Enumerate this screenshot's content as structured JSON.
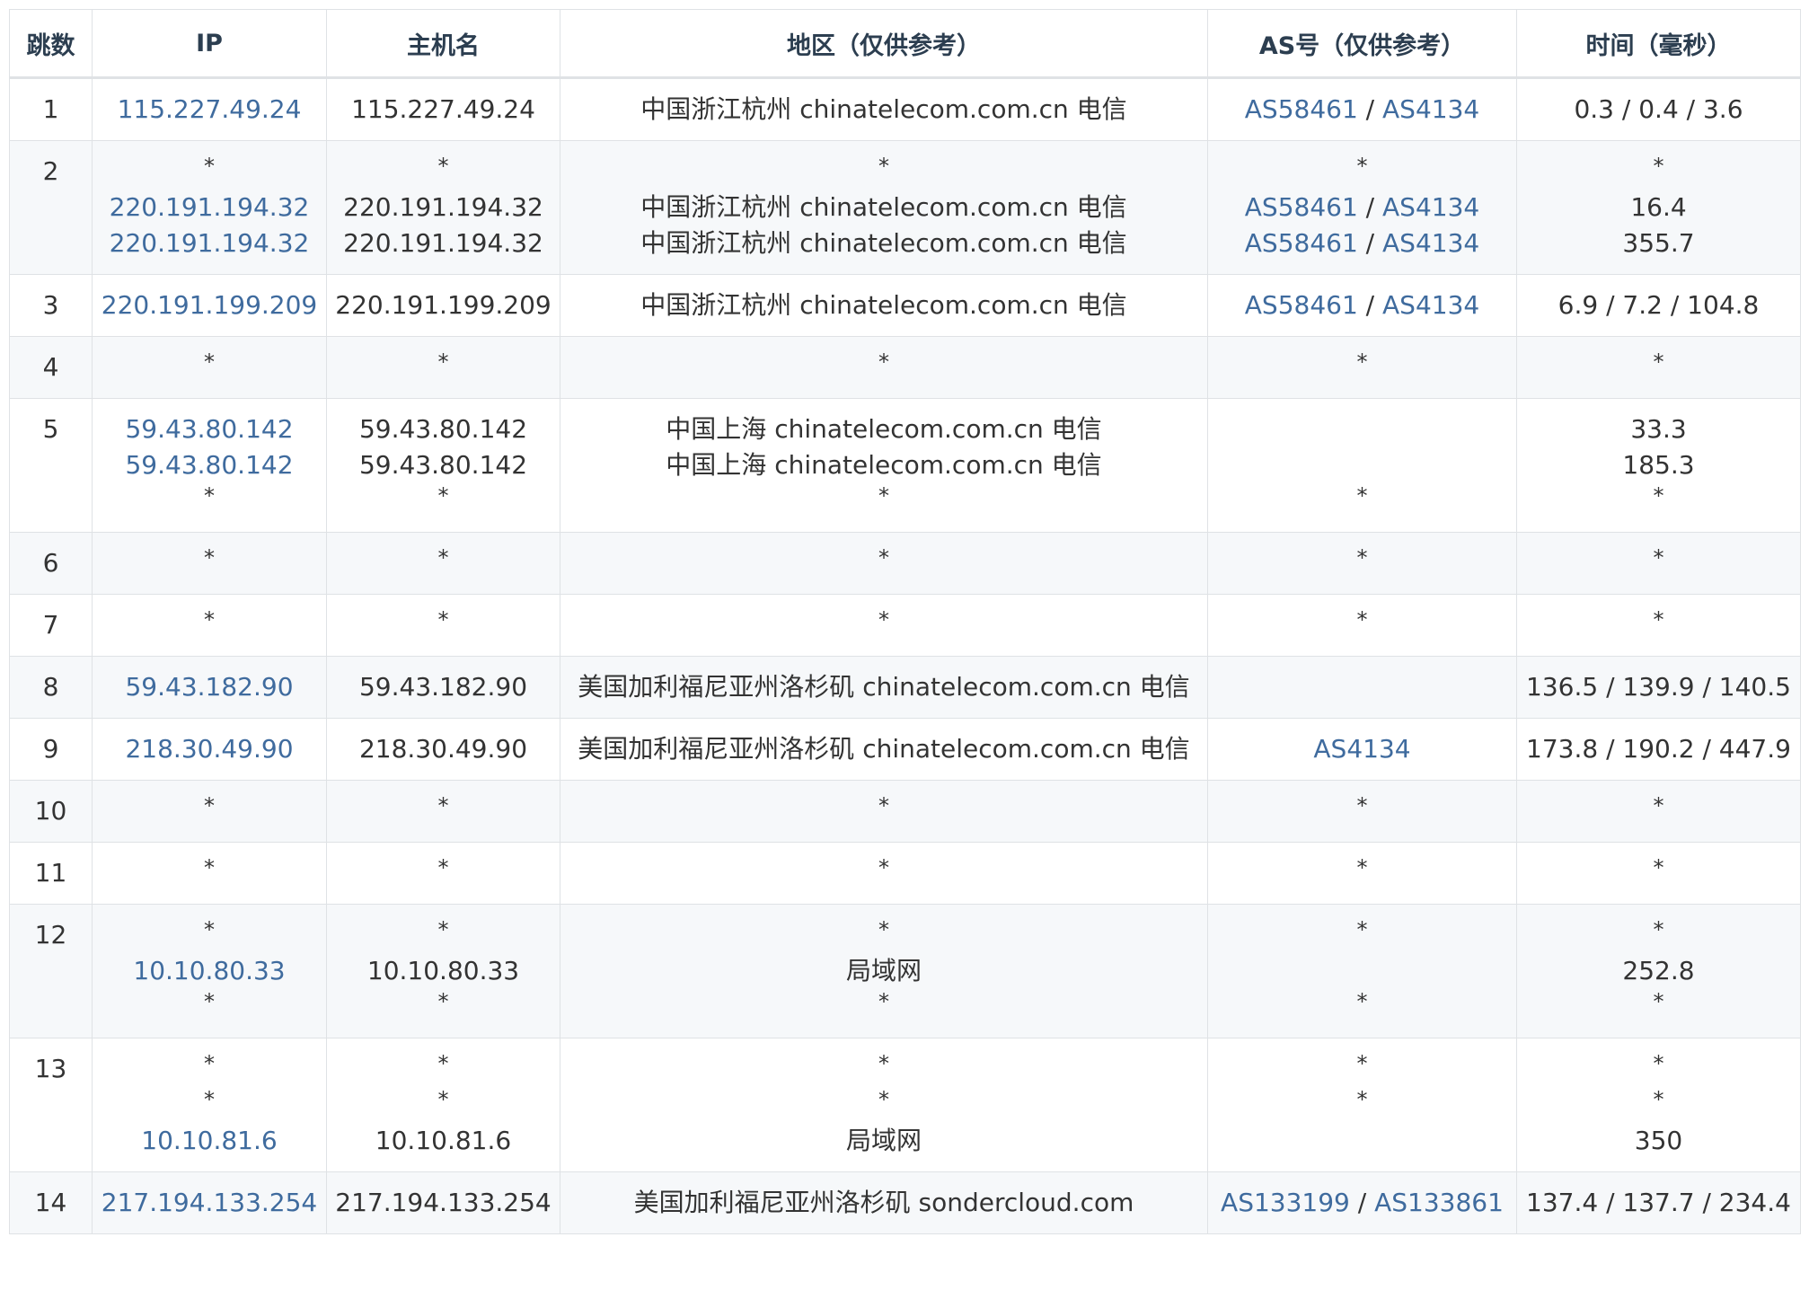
{
  "headers": [
    "跳数",
    "IP",
    "主机名",
    "地区（仅供参考）",
    "AS号（仅供参考）",
    "时间（毫秒）"
  ],
  "rows": [
    {
      "hop": "1",
      "ip": [
        "115.227.49.24"
      ],
      "host": [
        "115.227.49.24"
      ],
      "region": [
        "中国浙江杭州 chinatelecom.com.cn 电信"
      ],
      "as": [
        [
          "AS58461",
          "AS4134"
        ]
      ],
      "time": [
        "0.3 / 0.4 / 3.6"
      ]
    },
    {
      "hop": "2",
      "ip": [
        "*",
        "220.191.194.32",
        "220.191.194.32"
      ],
      "host": [
        "*",
        "220.191.194.32",
        "220.191.194.32"
      ],
      "region": [
        "*",
        "中国浙江杭州 chinatelecom.com.cn 电信",
        "中国浙江杭州 chinatelecom.com.cn 电信"
      ],
      "as": [
        [
          "*"
        ],
        [
          "AS58461",
          "AS4134"
        ],
        [
          "AS58461",
          "AS4134"
        ]
      ],
      "time": [
        "*",
        "16.4",
        "355.7"
      ]
    },
    {
      "hop": "3",
      "ip": [
        "220.191.199.209"
      ],
      "host": [
        "220.191.199.209"
      ],
      "region": [
        "中国浙江杭州 chinatelecom.com.cn 电信"
      ],
      "as": [
        [
          "AS58461",
          "AS4134"
        ]
      ],
      "time": [
        "6.9 / 7.2 / 104.8"
      ]
    },
    {
      "hop": "4",
      "ip": [
        "*"
      ],
      "host": [
        "*"
      ],
      "region": [
        "*"
      ],
      "as": [
        [
          "*"
        ]
      ],
      "time": [
        "*"
      ]
    },
    {
      "hop": "5",
      "ip": [
        "59.43.80.142",
        "59.43.80.142",
        "*"
      ],
      "host": [
        "59.43.80.142",
        "59.43.80.142",
        "*"
      ],
      "region": [
        "中国上海 chinatelecom.com.cn 电信",
        "中国上海 chinatelecom.com.cn 电信",
        "*"
      ],
      "as": [
        [],
        [],
        [
          "*"
        ]
      ],
      "time": [
        "33.3",
        "185.3",
        "*"
      ]
    },
    {
      "hop": "6",
      "ip": [
        "*"
      ],
      "host": [
        "*"
      ],
      "region": [
        "*"
      ],
      "as": [
        [
          "*"
        ]
      ],
      "time": [
        "*"
      ]
    },
    {
      "hop": "7",
      "ip": [
        "*"
      ],
      "host": [
        "*"
      ],
      "region": [
        "*"
      ],
      "as": [
        [
          "*"
        ]
      ],
      "time": [
        "*"
      ]
    },
    {
      "hop": "8",
      "ip": [
        "59.43.182.90"
      ],
      "host": [
        "59.43.182.90"
      ],
      "region": [
        "美国加利福尼亚州洛杉矶 chinatelecom.com.cn 电信"
      ],
      "as": [
        []
      ],
      "time": [
        "136.5 / 139.9 / 140.5"
      ]
    },
    {
      "hop": "9",
      "ip": [
        "218.30.49.90"
      ],
      "host": [
        "218.30.49.90"
      ],
      "region": [
        "美国加利福尼亚州洛杉矶 chinatelecom.com.cn 电信"
      ],
      "as": [
        [
          "AS4134"
        ]
      ],
      "time": [
        "173.8 / 190.2 / 447.9"
      ]
    },
    {
      "hop": "10",
      "ip": [
        "*"
      ],
      "host": [
        "*"
      ],
      "region": [
        "*"
      ],
      "as": [
        [
          "*"
        ]
      ],
      "time": [
        "*"
      ]
    },
    {
      "hop": "11",
      "ip": [
        "*"
      ],
      "host": [
        "*"
      ],
      "region": [
        "*"
      ],
      "as": [
        [
          "*"
        ]
      ],
      "time": [
        "*"
      ]
    },
    {
      "hop": "12",
      "ip": [
        "*",
        "10.10.80.33",
        "*"
      ],
      "host": [
        "*",
        "10.10.80.33",
        "*"
      ],
      "region": [
        "*",
        "局域网",
        "*"
      ],
      "as": [
        [
          "*"
        ],
        [],
        [
          "*"
        ]
      ],
      "time": [
        "*",
        "252.8",
        "*"
      ]
    },
    {
      "hop": "13",
      "ip": [
        "*",
        "*",
        "10.10.81.6"
      ],
      "host": [
        "*",
        "*",
        "10.10.81.6"
      ],
      "region": [
        "*",
        "*",
        "局域网"
      ],
      "as": [
        [
          "*"
        ],
        [
          "*"
        ],
        []
      ],
      "time": [
        "*",
        "*",
        "350"
      ]
    },
    {
      "hop": "14",
      "ip": [
        "217.194.133.254"
      ],
      "host": [
        "217.194.133.254"
      ],
      "region": [
        "美国加利福尼亚州洛杉矶 sondercloud.com"
      ],
      "as": [
        [
          "AS133199",
          "AS133861"
        ]
      ],
      "time": [
        "137.4 / 137.7 / 234.4"
      ]
    }
  ],
  "colors": {
    "link": "#3f6b9e",
    "border": "#dfe2e5",
    "stripe": "#f6f8fa",
    "header_text": "#2c3e50"
  }
}
